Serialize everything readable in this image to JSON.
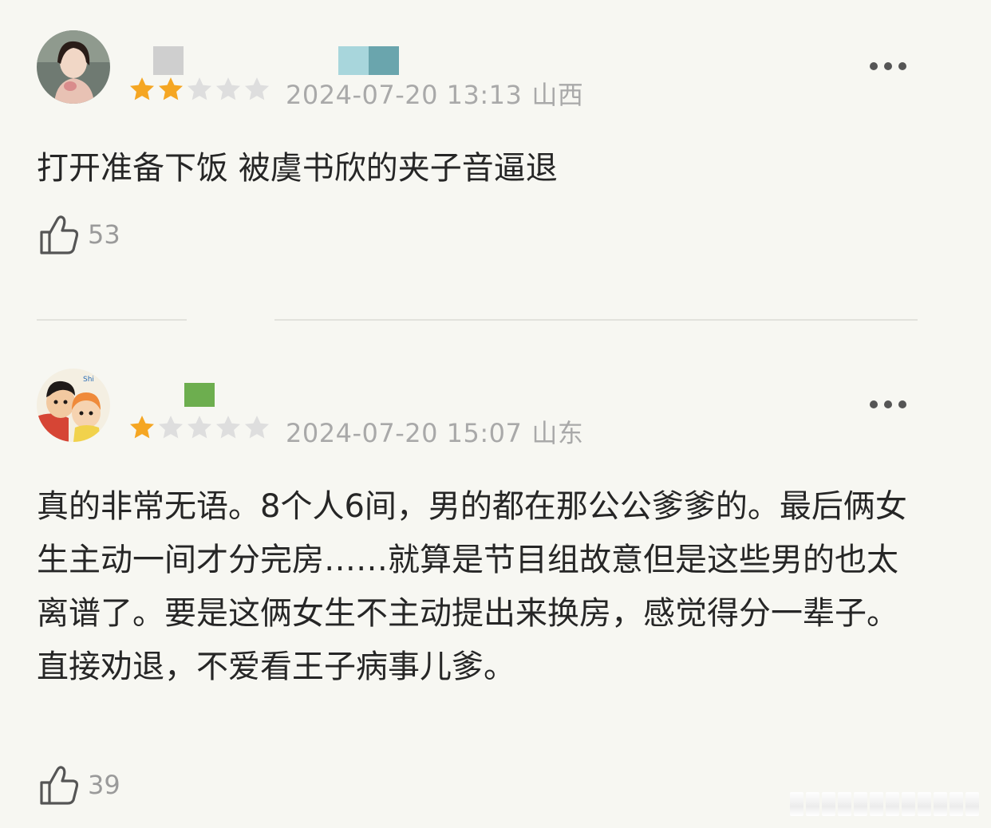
{
  "reviews": [
    {
      "username": "",
      "rating": 2,
      "max_rating": 5,
      "date": "2024-07-20 13:13",
      "region": "山西",
      "text": "打开准备下饭 被虞书欣的夹子音逼退",
      "likes": "53"
    },
    {
      "username": "",
      "rating": 1,
      "max_rating": 5,
      "date": "2024-07-20 15:07",
      "region": "山东",
      "text": "真的非常无语。8个人6间，男的都在那公公爹爹的。最后俩女生主动一间才分完房……就算是节目组故意但是这些男的也太离谱了。要是这俩女生不主动提出来换房，感觉得分一辈子。直接劝退，不爱看王子病事儿爹。",
      "likes": "39"
    }
  ],
  "colors": {
    "background": "#f7f7f2",
    "star_filled": "#f5a623",
    "star_empty": "#dedede",
    "meta_text": "#a9a9a9",
    "body_text": "#262626"
  },
  "icons": {
    "like": "thumbs-up-icon",
    "more": "more-dots-icon",
    "star": "star-icon"
  }
}
